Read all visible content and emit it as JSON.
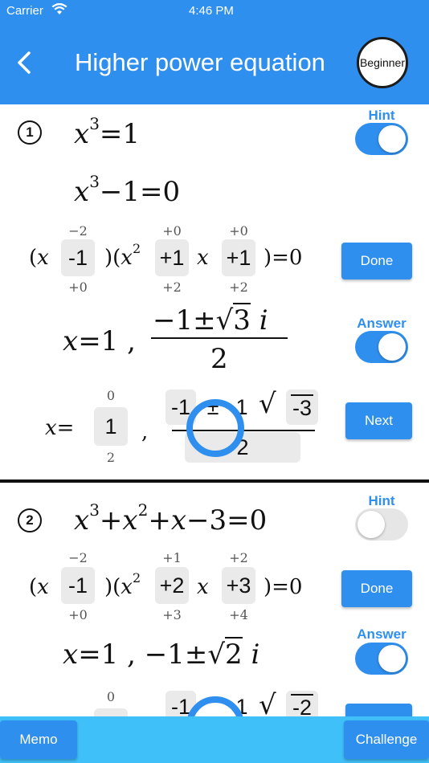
{
  "status": {
    "carrier": "Carrier",
    "time": "4:46 PM"
  },
  "header": {
    "title": "Higher power equation",
    "badge": "Beginner"
  },
  "problem1": {
    "number": "1",
    "hint_label": "Hint",
    "answer_label": "Answer",
    "done_label": "Done",
    "next_label": "Next",
    "factor_cells": [
      "-1",
      "+1",
      "+1"
    ],
    "factor_top": [
      "−2",
      "+0",
      "+0"
    ],
    "factor_bottom": [
      "+0",
      "+2",
      "+2"
    ],
    "answer_cells": [
      "1",
      "-1",
      "±",
      "1",
      "-3",
      "2"
    ],
    "answer_top": "0",
    "answer_bottom": "2",
    "answer_sqrt_val": "3",
    "answer_num_prefix": "−1±",
    "answer_denominator": "2"
  },
  "problem2": {
    "number": "2",
    "hint_label": "Hint",
    "answer_label": "Answer",
    "done_label": "Done",
    "factor_cells": [
      "-1",
      "+2",
      "+3"
    ],
    "factor_top": [
      "−2",
      "+1",
      "+2"
    ],
    "factor_bottom": [
      "+0",
      "+3",
      "+4"
    ],
    "answer_sqrt_val": "2",
    "answer_cells": [
      "-1",
      "1",
      "-2"
    ],
    "answer_top": "0"
  },
  "bottom": {
    "memo": "Memo",
    "challenge": "Challenge"
  },
  "colors": {
    "primary": "#2f8fee",
    "bottom_bar": "#40c0f8"
  }
}
